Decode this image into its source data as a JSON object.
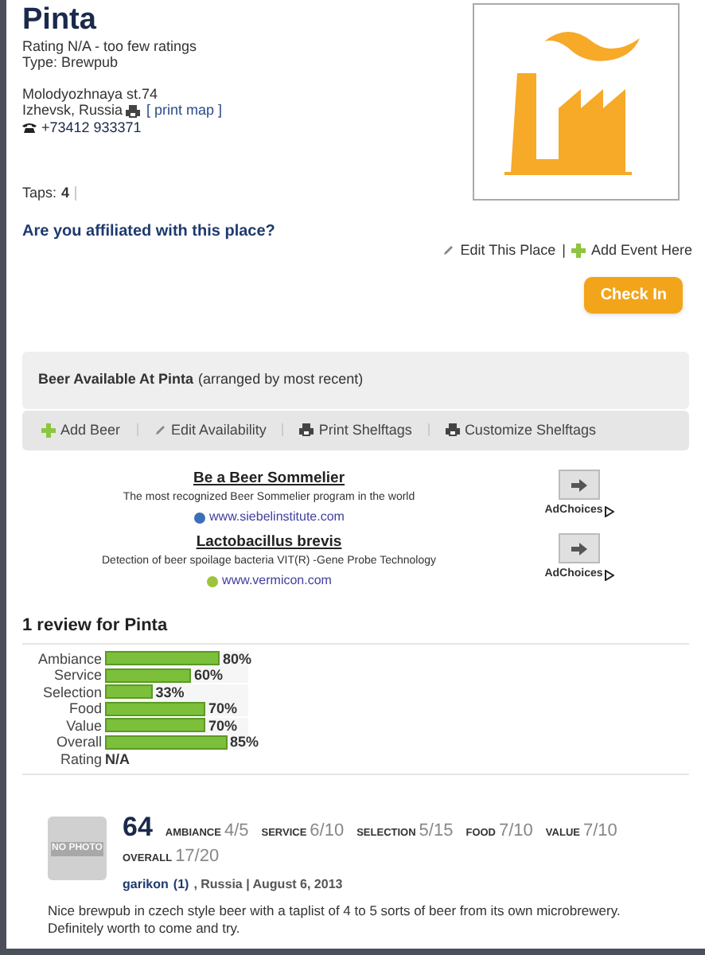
{
  "place": {
    "name": "Pinta",
    "rating": "Rating N/A - too few ratings",
    "type": "Type: Brewpub",
    "street": "Molodyozhnaya st.74",
    "city": "Izhevsk, Russia",
    "print_map": "[ print map ]",
    "phone": "+73412 933371",
    "taps_label": "Taps:",
    "taps": "4",
    "affiliated": "Are you affiliated with this place?"
  },
  "place_actions": [
    {
      "kind": "edit",
      "label": "Edit This Place"
    },
    {
      "kind": "add",
      "label": "Add Event Here"
    }
  ],
  "separator": "|",
  "check_in": "Check In",
  "beer_box": {
    "title": "Beer Available At Pinta",
    "note": "(arranged by most recent)",
    "actions": [
      {
        "kind": "add",
        "label": "Add Beer"
      },
      {
        "kind": "edit",
        "label": "Edit Availability"
      },
      {
        "kind": "print",
        "label": "Print Shelftags"
      },
      {
        "kind": "print",
        "label": "Customize Shelftags"
      }
    ]
  },
  "ads": [
    {
      "title": "Be a Beer Sommelier",
      "text": "The most recognized Beer Sommelier program in the world",
      "url": "www.siebelinstitute.com",
      "color": "#3b6fb6",
      "choices": "AdChoices"
    },
    {
      "title": "Lactobacillus brevis",
      "text": "Detection of beer spoilage bacteria VIT(R) -Gene Probe Technology",
      "url": "www.vermicon.com",
      "color": "#9cc43c",
      "choices": "AdChoices"
    }
  ],
  "reviews_heading": "1 review for Pinta",
  "ratings": [
    {
      "label": "Ambiance",
      "level": 0.8,
      "reading": "80%"
    },
    {
      "label": "Service",
      "level": 0.6,
      "reading": "60%"
    },
    {
      "label": "Selection",
      "level": 0.33,
      "reading": "33%"
    },
    {
      "label": "Food",
      "level": 0.7,
      "reading": "70%"
    },
    {
      "label": "Value",
      "level": 0.7,
      "reading": "70%"
    },
    {
      "label": "Overall",
      "level": 0.85,
      "reading": "85%"
    }
  ],
  "rating_row": {
    "label": "Rating",
    "value": "N/A"
  },
  "review": {
    "no_photo": "NO PHOTO",
    "score": "64",
    "parts": [
      {
        "label": "AMBIANCE",
        "value": "4/5"
      },
      {
        "label": "SERVICE",
        "value": "6/10"
      },
      {
        "label": "SELECTION",
        "value": "5/15"
      },
      {
        "label": "FOOD",
        "value": "7/10"
      },
      {
        "label": "VALUE",
        "value": "7/10"
      },
      {
        "label": "OVERALL",
        "value": "17/20"
      }
    ],
    "author": "garikon",
    "author_count": "(1)",
    "meta": ", Russia | August 6, 2013",
    "text": "Nice brewpub in czech style beer with a taplist of 4 to 5 sorts of beer from its own microbrewery. Definitely worth to come and try."
  }
}
